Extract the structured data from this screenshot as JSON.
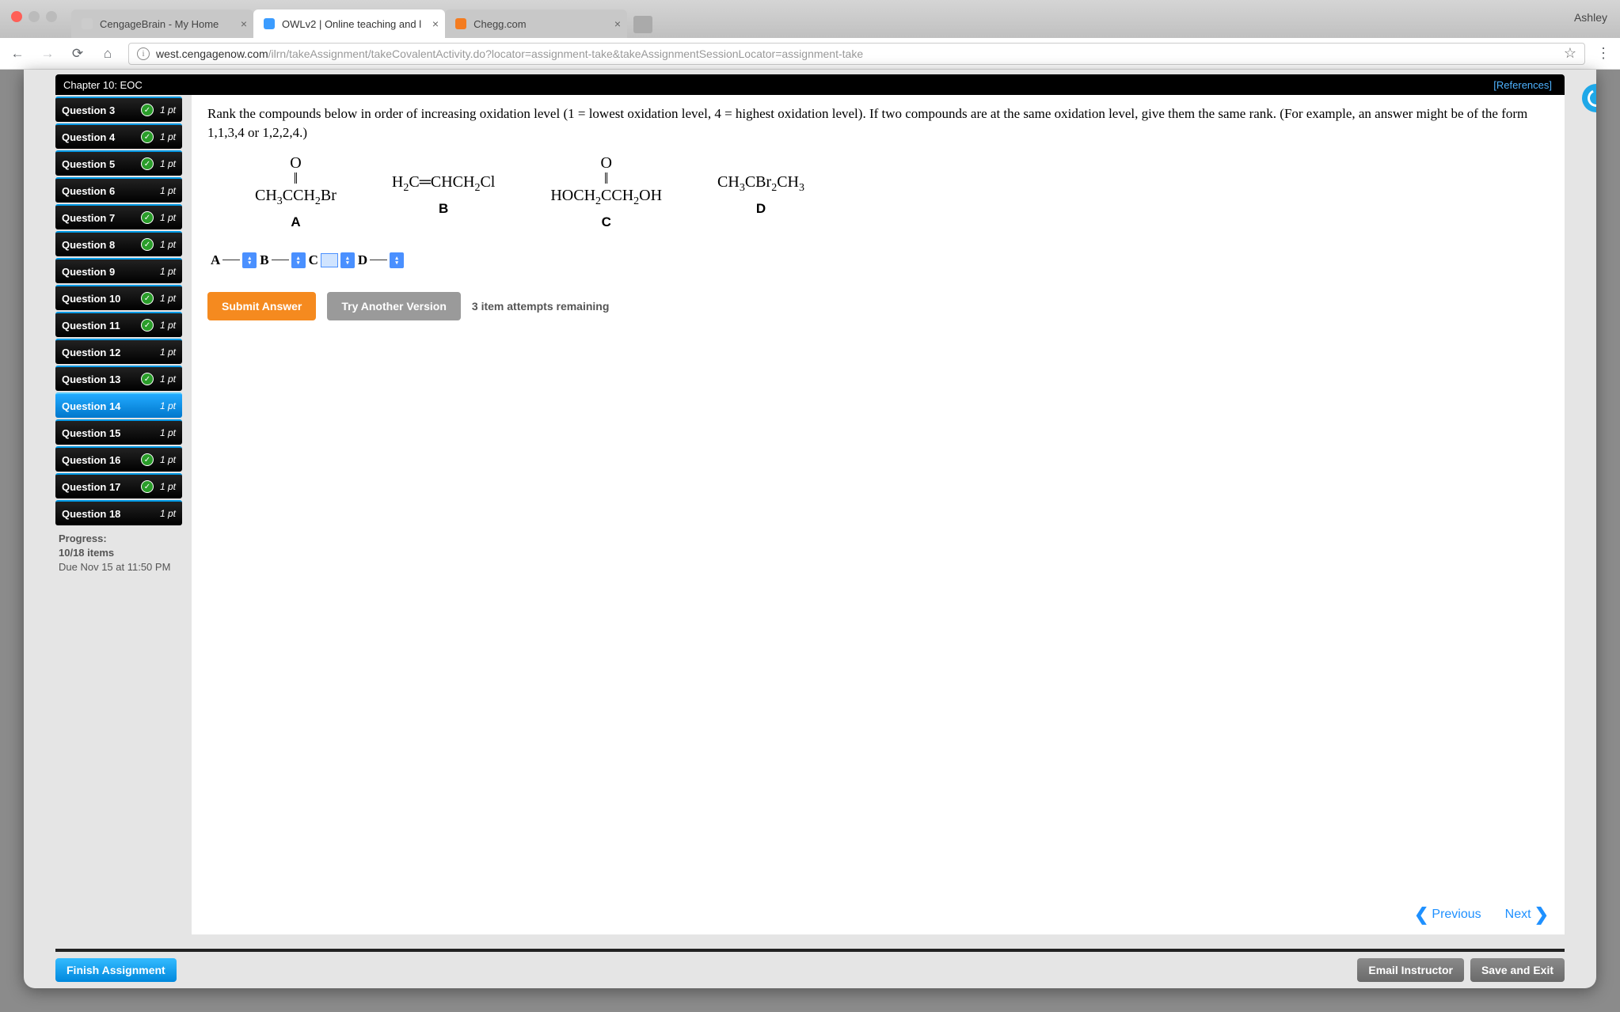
{
  "browser": {
    "profile": "Ashley",
    "tabs": [
      {
        "title": "CengageBrain - My Home",
        "active": false,
        "favcolor": "#ccc"
      },
      {
        "title": "OWLv2 | Online teaching and l",
        "active": true,
        "favcolor": "#3b9cff"
      },
      {
        "title": "Chegg.com",
        "active": false,
        "favcolor": "#f47c20"
      }
    ],
    "url_host": "west.cengagenow.com",
    "url_path": "/ilrn/takeAssignment/takeCovalentActivity.do?locator=assignment-take&takeAssignmentSessionLocator=assignment-take"
  },
  "chapter": {
    "title": "Chapter 10: EOC",
    "references": "[References]"
  },
  "sidebar": {
    "questions": [
      {
        "label": "Question 3",
        "pts": "1 pt",
        "done": true,
        "active": false
      },
      {
        "label": "Question 4",
        "pts": "1 pt",
        "done": true,
        "active": false
      },
      {
        "label": "Question 5",
        "pts": "1 pt",
        "done": true,
        "active": false
      },
      {
        "label": "Question 6",
        "pts": "1 pt",
        "done": false,
        "active": false
      },
      {
        "label": "Question 7",
        "pts": "1 pt",
        "done": true,
        "active": false
      },
      {
        "label": "Question 8",
        "pts": "1 pt",
        "done": true,
        "active": false
      },
      {
        "label": "Question 9",
        "pts": "1 pt",
        "done": false,
        "active": false
      },
      {
        "label": "Question 10",
        "pts": "1 pt",
        "done": true,
        "active": false
      },
      {
        "label": "Question 11",
        "pts": "1 pt",
        "done": true,
        "active": false
      },
      {
        "label": "Question 12",
        "pts": "1 pt",
        "done": false,
        "active": false
      },
      {
        "label": "Question 13",
        "pts": "1 pt",
        "done": true,
        "active": false
      },
      {
        "label": "Question 14",
        "pts": "1 pt",
        "done": false,
        "active": true
      },
      {
        "label": "Question 15",
        "pts": "1 pt",
        "done": false,
        "active": false
      },
      {
        "label": "Question 16",
        "pts": "1 pt",
        "done": true,
        "active": false
      },
      {
        "label": "Question 17",
        "pts": "1 pt",
        "done": true,
        "active": false
      },
      {
        "label": "Question 18",
        "pts": "1 pt",
        "done": false,
        "active": false
      }
    ],
    "progress_label": "Progress:",
    "progress_count": "10/18 items",
    "due_label": "Due Nov 15 at 11:50 PM"
  },
  "question": {
    "prompt": "Rank the compounds below in order of increasing oxidation level (1 = lowest oxidation level, 4 = highest oxidation level). If two compounds are at the same oxidation level, give them the same rank. (For example, an answer might be of the form 1,1,3,4 or 1,2,2,4.)",
    "compounds": [
      {
        "key": "A",
        "formula_html": "<div class='carbonyl'>O<br>‖</div>CH<sub>3</sub>CCH<sub>2</sub>Br"
      },
      {
        "key": "B",
        "formula_html": "&nbsp;<br>H<sub>2</sub>C&#9552;CHCH<sub>2</sub>Cl"
      },
      {
        "key": "C",
        "formula_html": "<div class='carbonyl'>O<br>‖</div>HOCH<sub>2</sub>CCH<sub>2</sub>OH"
      },
      {
        "key": "D",
        "formula_html": "&nbsp;<br>CH<sub>3</sub>CBr<sub>2</sub>CH<sub>3</sub>"
      }
    ],
    "answer_labels": [
      "A",
      "B",
      "C",
      "D"
    ]
  },
  "buttons": {
    "submit": "Submit Answer",
    "try_another": "Try Another Version",
    "attempts": "3 item attempts remaining",
    "previous": "Previous",
    "next": "Next",
    "finish": "Finish Assignment",
    "email": "Email Instructor",
    "save_exit": "Save and Exit"
  }
}
